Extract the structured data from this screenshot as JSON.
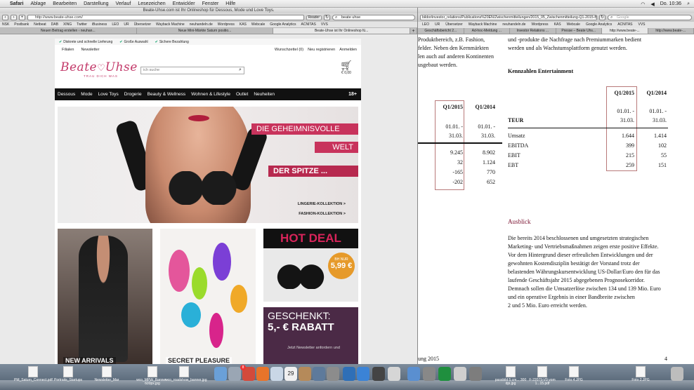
{
  "menubar": {
    "items": [
      "Safari",
      "Ablage",
      "Bearbeiten",
      "Darstellung",
      "Verlauf",
      "Lesezeichen",
      "Entwickler",
      "Fenster",
      "Hilfe"
    ],
    "clock": "Do. 10:36"
  },
  "safari": {
    "title": "Beate-Uhse.com ist Ihr Onlineshop für Dessous, Mode und Love Toys.",
    "url": "http://www.beate-uhse.com/",
    "reader_label": "Reader",
    "search_value": "beate uhse",
    "bookmarks": [
      "NSK",
      "Postbank",
      "Netbeat",
      "DAB",
      "XING",
      "Twitter",
      "iBusiness",
      "LEO",
      "UR",
      "Übersetzer",
      "Wayback Machine",
      "neuhandeln.de",
      "Wordpress",
      "KAS",
      "Webcale",
      "Google Analytics",
      "ACNITAS",
      "VVS"
    ],
    "tabs": [
      "Neuen Beitrag erstellen ‹ neuhan...",
      "Neue Mini-Märkte Saturn positio...",
      "Beate-Uhse ist Ihr Onlineshop fü..."
    ]
  },
  "shop": {
    "notices": [
      "Diskrete und schnelle Lieferung",
      "Große Auswahl",
      "Sichere Bezahlung"
    ],
    "toplinks_left": [
      "Filialen",
      "Newsletter"
    ],
    "toplinks_right": [
      "Wunschzettel (0)",
      "Neu registrieren",
      "Anmelden"
    ],
    "logo_text_left": "Beate",
    "logo_text_right": "Uhse",
    "logo_tagline": "TRAU DICH WAS",
    "search_placeholder": "ich suche",
    "cart_total": "€ 0,00",
    "nav": [
      "Dessous",
      "Mode",
      "Love Toys",
      "Drogerie",
      "Beauty & Wellness",
      "Wohnen & Lifestyle",
      "Outlet",
      "Neuheiten"
    ],
    "age_badge": "18+",
    "hero": {
      "line1": "DIE GEHEIMNISVOLLE",
      "line2": "WELT",
      "line3": "DER SPITZE ...",
      "link1": "LINGERIE-KOLLEKTION >",
      "link2": "FASHION-KOLLEKTION >"
    },
    "tile1_label": "NEW ARRIVALS",
    "tile2_label": "SECRET PLEASURE",
    "hotdeal": {
      "title": "HOT DEAL",
      "price_prefix": "BH NUR",
      "price": "5,99 €"
    },
    "gift": {
      "line1": "GESCHENKT:",
      "line2": "5,- € RABATT",
      "line3": "Jetzt Newsletter anfordern und"
    }
  },
  "pdf": {
    "url": "bildor/investor_relations/Publications%20EN/Zwischenmitteilungen/2015_05_Zwischenmitteilung-Q1-2015-BU_de_10-15_Online.pdf",
    "search_placeholder": "Google",
    "bookmarks": [
      "LEO",
      "UR",
      "Übersetzer",
      "Wayback Machine",
      "neuhandeln.de",
      "Wordpress",
      "KAS",
      "Webcale",
      "Google Analytics",
      "ACNITAS",
      "VVS"
    ],
    "tabs": [
      "Geschäftsbericht 2...",
      "Ad-hoc-Meldung ...",
      "Investor Relations ...",
      "Presse – Beate Uhs...",
      "http://www.beate-...",
      "http://www.beate-..."
    ],
    "left_text": [
      "Produktbereich, z.B. Fashion,",
      "felder. Neben den Kernmärkten",
      "len auch auf anderen Kontinenten",
      "usgebaut werden."
    ],
    "right_text": [
      "und -produkte die Nachfrage nach Premiummarken bedient",
      "werden und als Wachstumsplattform genutzt werden."
    ],
    "kennzahlen_title": "Kennzahlen Entertainment",
    "left_table": {
      "headers": [
        "Q1/2015",
        "Q1/2014"
      ],
      "dates": [
        [
          "01.01. -",
          "01.01. -"
        ],
        [
          "31.03.",
          "31.03."
        ]
      ],
      "rows": [
        [
          "9.245",
          "8.902"
        ],
        [
          "32",
          "1.124"
        ],
        [
          "-165",
          "770"
        ],
        [
          "-202",
          "652"
        ]
      ]
    },
    "right_table": {
      "headers": [
        "Q1/2015",
        "Q1/2014"
      ],
      "dates": [
        [
          "01.01. -",
          "01.01. -"
        ],
        [
          "31.03.",
          "31.03."
        ]
      ],
      "unit": "TEUR",
      "rows": [
        {
          "label": "Umsatz",
          "q1": "1.644",
          "q2": "1.414"
        },
        {
          "label": "EBITDA",
          "q1": "399",
          "q2": "102"
        },
        {
          "label": "EBIT",
          "q1": "215",
          "q2": "55"
        },
        {
          "label": "EBT",
          "q1": "259",
          "q2": "151"
        }
      ]
    },
    "ausblick_title": "Ausblick",
    "ausblick_lines": [
      "Die bereits 2014 beschlossenen und umgesetzten strategischen",
      "Marketing- und Vertriebsmaßnahmen zeigen erste positive Effekte.",
      "Vor dem Hintergrund dieser erfreulichen Entwicklungen und der",
      "gewohnten Kostendisziplin bestätigt der Vorstand trotz der",
      "belastenden Währungskursentwicklung US-Dollar/Euro den für das",
      "laufende Geschäftsjahr 2015 abgegebenen Prognosekorridor.",
      "Demnach sollen die Umsatzerlöse zwischen 134 und 139 Mio. Euro",
      "und ein operative Ergebnis in einer Bandbreite zwischen",
      "2 und 5 Mio. Euro erreicht werden."
    ],
    "footer_left": "ung 2015",
    "footer_right": "4"
  },
  "dock": {
    "files": [
      "PM_Saturn_Connect.pdf",
      "Portraits_Startups",
      "Newsletter_Mar",
      "wco_MPW_Banner - 600px.jpg",
      "wco_roadshow_banner.jpg",
      "passbild 5 cm... 300 dpi.jpg",
      "F-22079-V9 vom 1...15.pdf",
      "Foto 4.JPG",
      "Foto 2.JPG"
    ],
    "calendar_day": "29",
    "badge": "8"
  }
}
